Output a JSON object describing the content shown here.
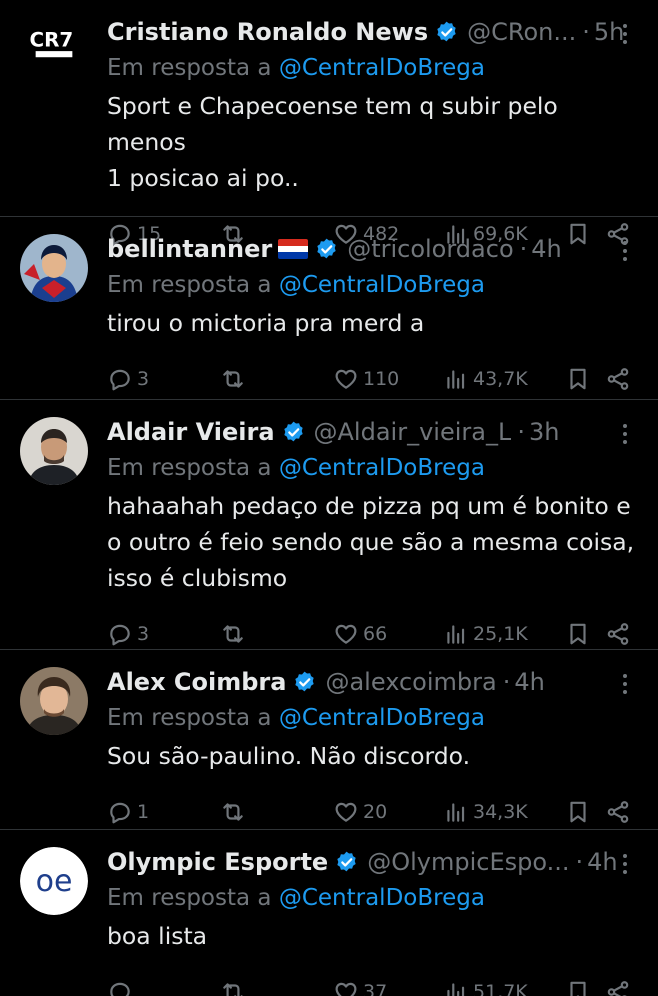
{
  "colors": {
    "background": "#000000",
    "text": "#e7e9ea",
    "muted": "#71767b",
    "accent": "#1d9bf0",
    "divider": "#2f3336"
  },
  "replying_prefix": "Em resposta a",
  "replies": [
    {
      "avatar": "cr7-news-logo",
      "avatar_text": "CR7",
      "name": "Cristiano Ronaldo News",
      "verified": true,
      "handle": "@CRon...",
      "dot": "·",
      "time": "5h",
      "replying_to": "@CentralDoBrega",
      "text": "Sport e Chapecoense tem q subir pelo menos\n1 posicao ai po..",
      "replies_count": "15",
      "retweets_count": "",
      "likes_count": "482",
      "views_count": "69,6K"
    },
    {
      "avatar": "superhero-avatar",
      "name": "bellintanner",
      "flag": "paraguay-flag",
      "verified": true,
      "handle": "@tricolordaco",
      "dot": "·",
      "time": "4h",
      "replying_to": "@CentralDoBrega",
      "text": "tirou o mictoria pra merd a",
      "replies_count": "3",
      "retweets_count": "",
      "likes_count": "110",
      "views_count": "43,7K"
    },
    {
      "avatar": "man-photo-avatar",
      "name": "Aldair Vieira",
      "verified": true,
      "handle": "@Aldair_vieira_L",
      "dot": "·",
      "time": "3h",
      "replying_to": "@CentralDoBrega",
      "text": "hahaahah pedaço de pizza pq um é bonito e\no outro é feio sendo que são a mesma coisa,\nisso é clubismo",
      "replies_count": "3",
      "retweets_count": "",
      "likes_count": "66",
      "views_count": "25,1K"
    },
    {
      "avatar": "man-photo-avatar",
      "name": "Alex Coimbra",
      "verified": true,
      "handle": "@alexcoimbra",
      "dot": "·",
      "time": "4h",
      "replying_to": "@CentralDoBrega",
      "text": "Sou são-paulino. Não discordo.",
      "replies_count": "1",
      "retweets_count": "",
      "likes_count": "20",
      "views_count": "34,3K"
    },
    {
      "avatar": "olympic-esporte-logo",
      "avatar_text": "oe",
      "name": "Olympic Esporte",
      "verified": true,
      "handle": "@OlympicEspo...",
      "dot": "·",
      "time": "4h",
      "replying_to": "@CentralDoBrega",
      "text": "boa lista",
      "replies_count": "",
      "retweets_count": "",
      "likes_count": "37",
      "views_count": "51,7K"
    }
  ]
}
